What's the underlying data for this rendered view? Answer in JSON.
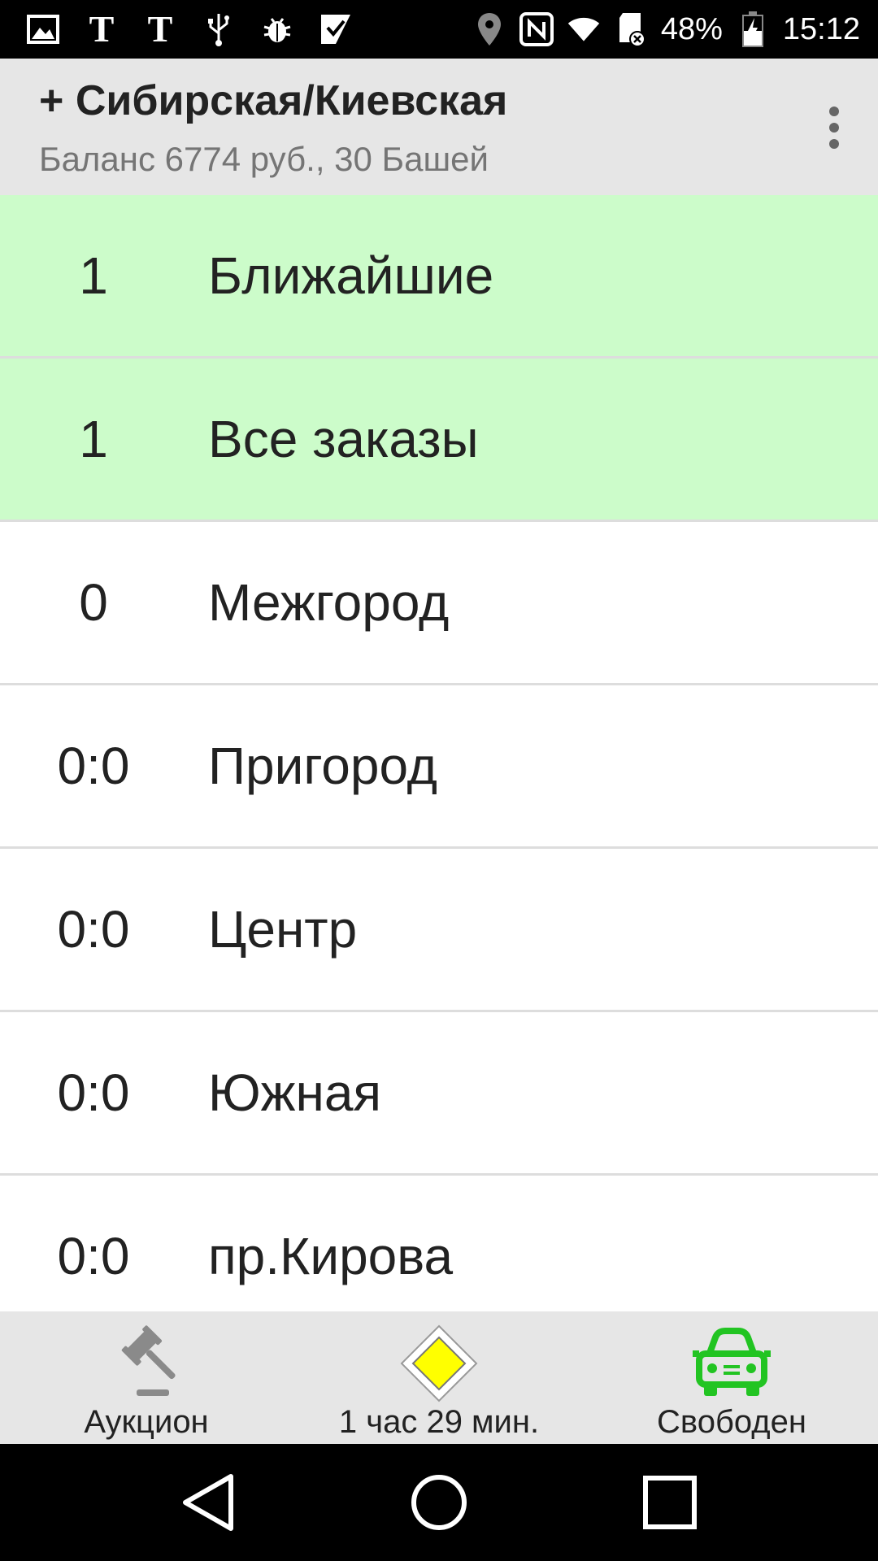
{
  "status_bar": {
    "battery_percent": "48%",
    "time": "15:12"
  },
  "header": {
    "title": "+ Сибирская/Киевская",
    "subtitle": "Баланс 6774 руб.,  30 Башей"
  },
  "list": [
    {
      "count": "1",
      "label": "Ближайшие",
      "highlight": true
    },
    {
      "count": "1",
      "label": "Все заказы",
      "highlight": true
    },
    {
      "count": "0",
      "label": "Межгород",
      "highlight": false
    },
    {
      "count": "0:0",
      "label": "Пригород",
      "highlight": false
    },
    {
      "count": "0:0",
      "label": "Центр",
      "highlight": false
    },
    {
      "count": "0:0",
      "label": "Южная",
      "highlight": false
    },
    {
      "count": "0:0",
      "label": "пр.Кирова",
      "highlight": false
    }
  ],
  "bottom_bar": {
    "auction_label": "Аукцион",
    "shift_label": "1 час 29 мин.",
    "status_label": "Свободен"
  },
  "colors": {
    "highlight_row": "#ccfcca",
    "status_green": "#22c422",
    "priority_sign_yellow": "#ffff00"
  }
}
